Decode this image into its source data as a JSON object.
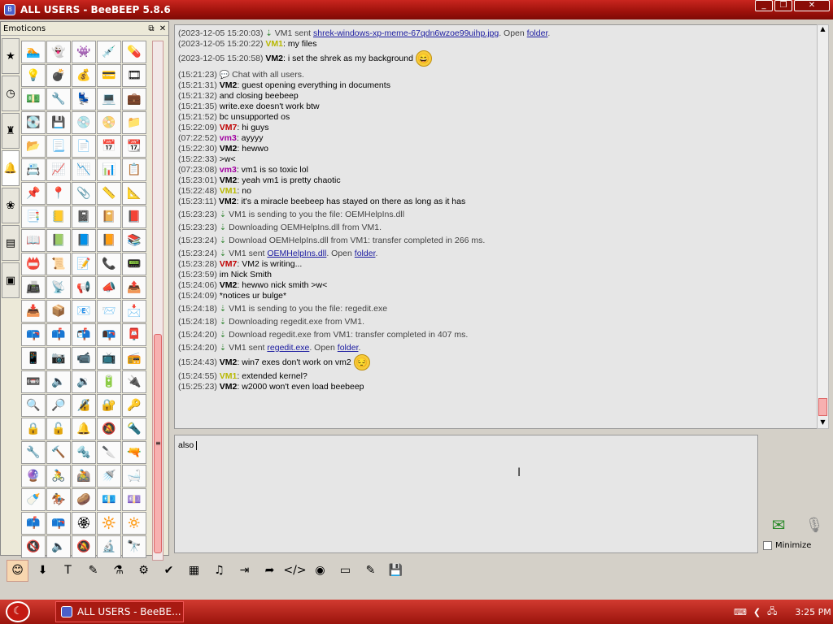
{
  "window": {
    "title": "ALL USERS - BeeBEEP 5.8.6"
  },
  "emoticons": {
    "title": "Emoticons",
    "tabs": [
      "★",
      "◷",
      "♜",
      "🔔",
      "❀",
      "▤",
      "▣"
    ],
    "cells": [
      "🏊",
      "👻",
      "👾",
      "💉",
      "💊",
      "💡",
      "💣",
      "💰",
      "💳",
      "🎞",
      "💵",
      "🔧",
      "💺",
      "💻",
      "💼",
      "💽",
      "💾",
      "💿",
      "📀",
      "📁",
      "📂",
      "📃",
      "📄",
      "📅",
      "📆",
      "📇",
      "📈",
      "📉",
      "📊",
      "📋",
      "📌",
      "📍",
      "📎",
      "📏",
      "📐",
      "📑",
      "📒",
      "📓",
      "📔",
      "📕",
      "📖",
      "📗",
      "📘",
      "📙",
      "📚",
      "📛",
      "📜",
      "📝",
      "📞",
      "📟",
      "📠",
      "📡",
      "📢",
      "📣",
      "📤",
      "📥",
      "📦",
      "📧",
      "📨",
      "📩",
      "📪",
      "📫",
      "📬",
      "📭",
      "📮",
      "📱",
      "📷",
      "📹",
      "📺",
      "📻",
      "📼",
      "🔈",
      "🔉",
      "🔋",
      "🔌",
      "🔍",
      "🔎",
      "🔏",
      "🔐",
      "🔑",
      "🔒",
      "🔓",
      "🔔",
      "🔕",
      "🔦",
      "🔧",
      "🔨",
      "🔩",
      "🔪",
      "🔫",
      "🔮",
      "🚴",
      "🚵",
      "🚿",
      "🛁",
      "🍼",
      "🏇",
      "🥔",
      "💶",
      "💷",
      "📫",
      "📪",
      "🏵",
      "🔆",
      "🔅",
      "🔇",
      "🔈",
      "🔕",
      "🔬",
      "🔭"
    ]
  },
  "chat": {
    "lines": [
      {
        "ts": "(2023-12-05 15:20:03)",
        "kind": "file",
        "pre": "VM1 sent ",
        "link": "shrek-windows-xp-meme-67qdn6wzoe99uihp.jpg",
        "post": ". Open ",
        "link2": "folder",
        "post2": "."
      },
      {
        "ts": "(2023-12-05 15:20:22)",
        "kind": "msg",
        "user": "VM1",
        "color": "#b8b800",
        "text": "my files"
      },
      {
        "ts": "(2023-12-05 15:20:58)",
        "kind": "msg",
        "user": "VM2",
        "color": "#000000",
        "text": "i set the shrek as my background",
        "emoji": "😄",
        "tall": true
      },
      {
        "ts": "(15:21:23)",
        "kind": "sys",
        "icon": "💬",
        "text": "Chat with all users.",
        "gap": true
      },
      {
        "ts": "(15:21:31)",
        "kind": "msg",
        "user": "VM2",
        "color": "#000000",
        "text": "guest opening everything in documents"
      },
      {
        "ts": "(15:21:32)",
        "kind": "cont",
        "text": "and closing beebeep"
      },
      {
        "ts": "(15:21:35)",
        "kind": "cont",
        "text": "write.exe doesn't work btw"
      },
      {
        "ts": "(15:21:52)",
        "kind": "cont",
        "text": "bc unsupported os"
      },
      {
        "ts": "(15:22:09)",
        "kind": "msg",
        "user": "VM7",
        "color": "#c00000",
        "text": "hi guys"
      },
      {
        "ts": "(07:22:52)",
        "kind": "msg",
        "user": "vm3",
        "color": "#a000a0",
        "text": "ayyyy"
      },
      {
        "ts": "(15:22:30)",
        "kind": "msg",
        "user": "VM2",
        "color": "#000000",
        "text": "hewwo"
      },
      {
        "ts": "(15:22:33)",
        "kind": "cont",
        "text": ">w<"
      },
      {
        "ts": "(07:23:08)",
        "kind": "msg",
        "user": "vm3",
        "color": "#a000a0",
        "text": "vm1 is so toxic lol"
      },
      {
        "ts": "(15:23:01)",
        "kind": "msg",
        "user": "VM2",
        "color": "#000000",
        "text": "yeah vm1 is pretty chaotic"
      },
      {
        "ts": "(15:22:48)",
        "kind": "msg",
        "user": "VM1",
        "color": "#b8b800",
        "text": "no"
      },
      {
        "ts": "(15:23:11)",
        "kind": "msg",
        "user": "VM2",
        "color": "#000000",
        "text": "it's a miracle beebeep has stayed on there as long as it has"
      },
      {
        "ts": "(15:23:23)",
        "kind": "sys",
        "icon": "⇣",
        "text": "VM1 is sending to you the file: OEMHelpIns.dll",
        "gap": true
      },
      {
        "ts": "(15:23:23)",
        "kind": "sys",
        "icon": "⇣",
        "text": "Downloading OEMHelpIns.dll from VM1.",
        "gap": true
      },
      {
        "ts": "(15:23:24)",
        "kind": "sys",
        "icon": "⇣",
        "text": "Download OEMHelpIns.dll from VM1: transfer completed in 266 ms.",
        "gap": true
      },
      {
        "ts": "(15:23:24)",
        "kind": "file",
        "pre": "VM1 sent ",
        "link": "OEMHelpIns.dll",
        "post": ". Open ",
        "link2": "folder",
        "post2": ".",
        "gap": true
      },
      {
        "ts": "(15:23:28)",
        "kind": "msg",
        "user": "VM7",
        "color": "#c00000",
        "text": "VM2 is writing..."
      },
      {
        "ts": "(15:23:59)",
        "kind": "cont",
        "text": "im Nick Smith"
      },
      {
        "ts": "(15:24:06)",
        "kind": "msg",
        "user": "VM2",
        "color": "#000000",
        "text": "hewwo nick smith >w<"
      },
      {
        "ts": "(15:24:09)",
        "kind": "cont",
        "text": "*notices ur bulge*"
      },
      {
        "ts": "(15:24:18)",
        "kind": "sys",
        "icon": "⇣",
        "text": "VM1 is sending to you the file: regedit.exe",
        "gap": true
      },
      {
        "ts": "(15:24:18)",
        "kind": "sys",
        "icon": "⇣",
        "text": "Downloading regedit.exe from VM1.",
        "gap": true
      },
      {
        "ts": "(15:24:20)",
        "kind": "sys",
        "icon": "⇣",
        "text": "Download regedit.exe from VM1: transfer completed in 407 ms.",
        "gap": true
      },
      {
        "ts": "(15:24:20)",
        "kind": "file",
        "pre": "VM1 sent ",
        "link": "regedit.exe",
        "post": ". Open ",
        "link2": "folder",
        "post2": ".",
        "gap": true
      },
      {
        "ts": "(15:24:43)",
        "kind": "msg",
        "user": "VM2",
        "color": "#000000",
        "text": "win7 exes don't work on vm2",
        "emoji": "😔",
        "tall": true
      },
      {
        "ts": "(15:24:55)",
        "kind": "msg",
        "user": "VM1",
        "color": "#b8b800",
        "text": "extended kernel?"
      },
      {
        "ts": "(15:25:23)",
        "kind": "msg",
        "user": "VM2",
        "color": "#000000",
        "text": "w2000 won't even load beebeep"
      }
    ]
  },
  "input": {
    "value": "also "
  },
  "send": {
    "minimize_label": "Minimize"
  },
  "toolbar": {
    "icons": [
      "😊",
      "⬇",
      "T",
      "✎",
      "⚗",
      "⚙",
      "✔",
      "▦",
      "♫",
      "⇥",
      "➦",
      "</>",
      "◉",
      "▭",
      "✎",
      "💾"
    ]
  },
  "taskbar": {
    "task_label": "ALL USERS - BeeBE...",
    "clock": "3:25 PM"
  }
}
